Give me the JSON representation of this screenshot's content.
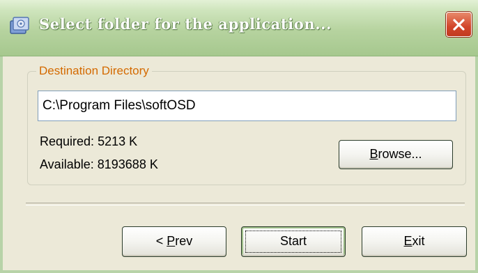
{
  "window": {
    "title": "Select folder for the application...",
    "icon": "app-installer-icon",
    "close_icon": "close-icon"
  },
  "destination": {
    "group_label": "Destination Directory",
    "path_value": "C:\\Program Files\\softOSD",
    "required_label": "Required:",
    "required_value": "5213 K",
    "available_label": "Available:",
    "available_value": "8193688 K",
    "browse_mnemonic": "B",
    "browse_rest": "rowse..."
  },
  "buttons": {
    "prev_prefix": "< ",
    "prev_mnemonic": "P",
    "prev_rest": "rev",
    "start_label": "Start",
    "exit_mnemonic": "E",
    "exit_rest": "xit"
  },
  "colors": {
    "titlebar": "#b6d39f",
    "close": "#d2452a",
    "group_label": "#d46a00",
    "dialog_bg": "#ece9d8"
  }
}
